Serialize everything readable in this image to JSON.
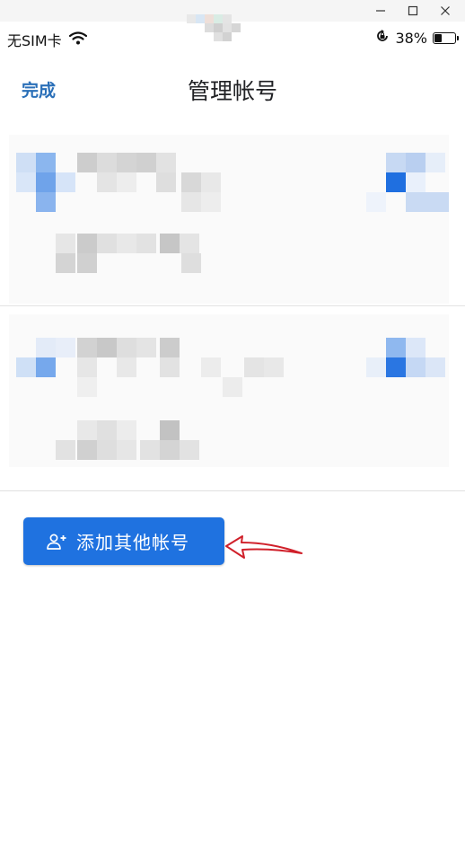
{
  "status_bar": {
    "carrier": "无SIM卡",
    "battery_percent": "38%",
    "battery_level": 0.38
  },
  "header": {
    "done_label": "完成",
    "title": "管理帐号"
  },
  "add_account": {
    "label": "添加其他帐号",
    "icon": "add-user-icon"
  },
  "colors": {
    "accent": "#1f72e0",
    "done_text": "#2a6fb8",
    "annotation_arrow": "#d0202a"
  }
}
